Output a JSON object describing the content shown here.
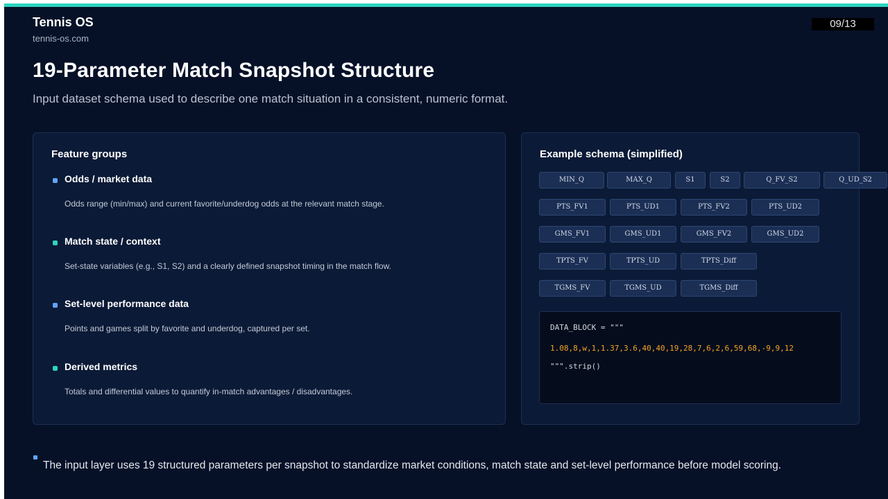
{
  "brand": {
    "name": "Tennis OS",
    "url": "tennis-os.com"
  },
  "page_indicator": "09/13",
  "title": "19-Parameter Match Snapshot Structure",
  "subtitle": "Input dataset schema used to describe one match situation in a consistent, numeric format.",
  "colors": {
    "accent": "#2dd4bf",
    "bullet_blue": "#60a5fa",
    "bullet_teal": "#2dd4bf",
    "code_data": "#f5a524",
    "background": "#061128"
  },
  "feature_groups": {
    "heading": "Feature groups",
    "items": [
      {
        "title": "Odds / market data",
        "description": "Odds range (min/max) and current favorite/underdog odds at the relevant match stage.",
        "bullet_color": "#60a5fa"
      },
      {
        "title": "Match state / context",
        "description": "Set-state variables (e.g., S1, S2) and a clearly defined snapshot timing in the match flow.",
        "bullet_color": "#2dd4bf"
      },
      {
        "title": "Set-level performance data",
        "description": "Points and games split by favorite and underdog, captured per set.",
        "bullet_color": "#60a5fa"
      },
      {
        "title": "Derived metrics",
        "description": "Totals and differential values to quantify in-match advantages / disadvantages.",
        "bullet_color": "#2dd4bf"
      }
    ]
  },
  "schema": {
    "heading": "Example schema (simplified)",
    "rows": [
      [
        "MIN_Q",
        "MAX_Q",
        "S1",
        "S2",
        "Q_FV_S2",
        "Q_UD_S2"
      ],
      [
        "PTS_FV1",
        "PTS_UD1",
        "PTS_FV2",
        "PTS_UD2"
      ],
      [
        "GMS_FV1",
        "GMS_UD1",
        "GMS_FV2",
        "GMS_UD2"
      ],
      [
        "TPTS_FV",
        "TPTS_UD",
        "TPTS_Diff"
      ],
      [
        "TGMS_FV",
        "TGMS_UD",
        "TGMS_Diff"
      ]
    ],
    "code": {
      "line1": "DATA_BLOCK = \"\"\"",
      "line2": "1.08,8,w,1,1.37,3.6,40,40,19,28,7,6,2,6,59,68,-9,9,12",
      "line3": "\"\"\".strip()"
    }
  },
  "footer": "The input layer uses 19 structured parameters per snapshot to standardize market conditions, match state and set-level performance before model scoring."
}
